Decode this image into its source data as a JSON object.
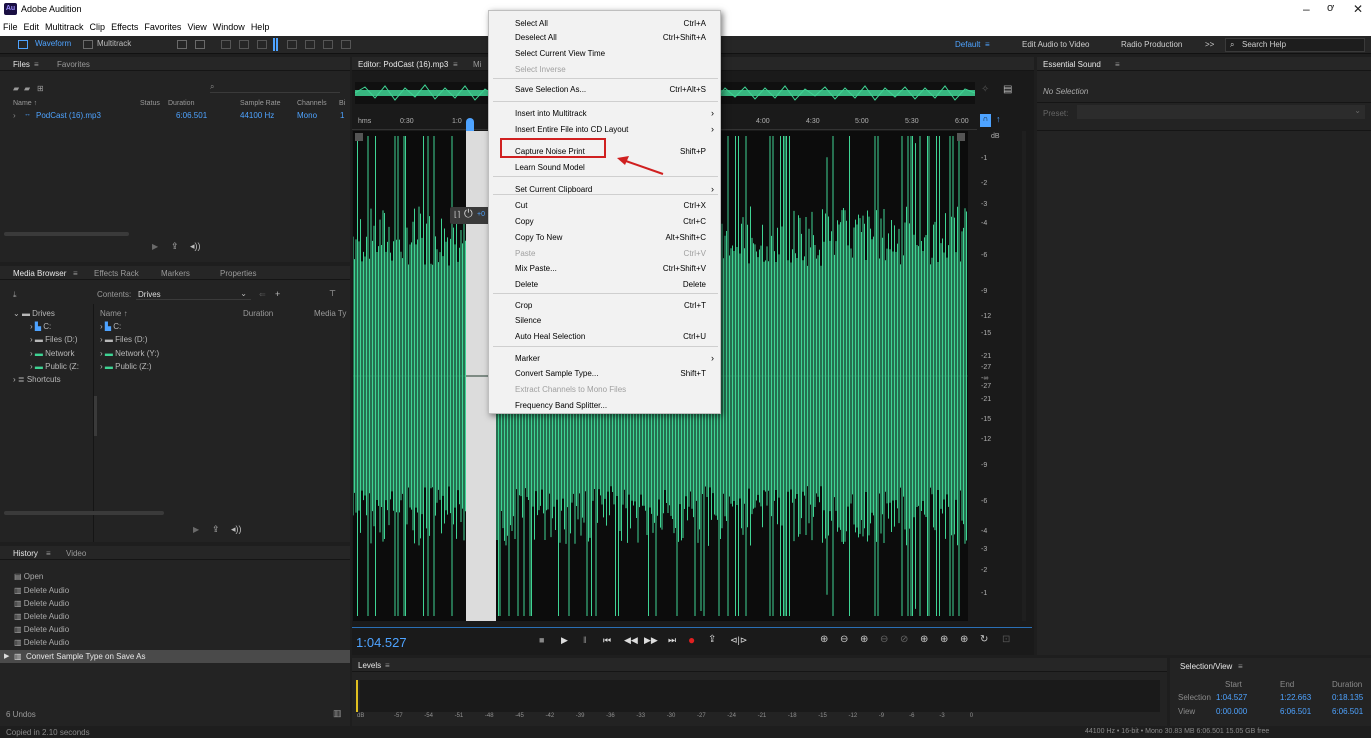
{
  "app": {
    "title": "Adobe Audition",
    "logo": "Au"
  },
  "menu": [
    "File",
    "Edit",
    "Multitrack",
    "Clip",
    "Effects",
    "Favorites",
    "View",
    "Window",
    "Help"
  ],
  "toolbar": {
    "waveform": "Waveform",
    "multitrack": "Multitrack",
    "workspaces": [
      "Default",
      "Edit Audio to Video",
      "Radio Production"
    ],
    "overflow": ">>",
    "search_placeholder": "Search Help"
  },
  "files_panel": {
    "tabs": [
      "Files",
      "Favorites"
    ],
    "columns": [
      "Name ↑",
      "Status",
      "Duration",
      "Sample Rate",
      "Channels",
      "Bi"
    ],
    "file": {
      "name": "PodCast (16).mp3",
      "duration": "6:06.501",
      "sample_rate": "44100 Hz",
      "channels": "Mono",
      "bits": "1"
    }
  },
  "media_browser": {
    "tabs": [
      "Media Browser",
      "Effects Rack",
      "Markers",
      "Properties"
    ],
    "contents_label": "Contents:",
    "contents_value": "Drives",
    "columns": [
      "Name ↑",
      "Duration",
      "Media Ty"
    ],
    "left_tree": [
      "Drives",
      "C:",
      "Files (D:)",
      "Network",
      "Public (Z:",
      "Shortcuts"
    ],
    "right_list": [
      "C:",
      "Files (D:)",
      "Network (Y:)",
      "Public (Z:)"
    ]
  },
  "history": {
    "tabs": [
      "History",
      "Video"
    ],
    "items": [
      "Open",
      "Delete Audio",
      "Delete Audio",
      "Delete Audio",
      "Delete Audio",
      "Delete Audio",
      "Convert Sample Type on Save As"
    ],
    "undos": "6 Undos"
  },
  "status_left": "Copied in 2.10 seconds",
  "editor": {
    "tab": "Editor: PodCast (16).mp3",
    "tab2": "Mi",
    "ruler_unit": "hms",
    "ruler": [
      "0:30",
      "1:0",
      "4:00",
      "4:30",
      "5:00",
      "5:30",
      "6:00"
    ],
    "db_unit": "dB",
    "db_scale": [
      "-1",
      "-2",
      "-3",
      "-4",
      "-6",
      "-9",
      "-12",
      "-15",
      "-21",
      "-27",
      "-∞",
      "-27",
      "-21",
      "-15",
      "-12",
      "-9",
      "-6",
      "-4",
      "-3",
      "-2",
      "-1"
    ],
    "time": "1:04.527",
    "gain_partial": "+0"
  },
  "essential_sound": {
    "title": "Essential Sound",
    "no_selection": "No Selection",
    "preset": "Preset:"
  },
  "levels": {
    "title": "Levels",
    "unit": "dB",
    "scale": [
      "-57",
      "-54",
      "-51",
      "-48",
      "-45",
      "-42",
      "-39",
      "-36",
      "-33",
      "-30",
      "-27",
      "-24",
      "-21",
      "-18",
      "-15",
      "-12",
      "-9",
      "-6",
      "-3",
      "0"
    ]
  },
  "selection_view": {
    "title": "Selection/View",
    "headers": [
      "Start",
      "End",
      "Duration"
    ],
    "selection": {
      "label": "Selection",
      "start": "1:04.527",
      "end": "1:22.663",
      "duration": "0:18.135"
    },
    "view": {
      "label": "View",
      "start": "0:00.000",
      "end": "6:06.501",
      "duration": "6:06.501"
    }
  },
  "status_right": "44100 Hz • 16-bit • Mono   30.83 MB   6:06.501   15.05 GB free",
  "context_menu": [
    {
      "label": "Select All",
      "shortcut": "Ctrl+A"
    },
    {
      "label": "Deselect All",
      "shortcut": "Ctrl+Shift+A"
    },
    {
      "label": "Select Current View Time",
      "shortcut": ""
    },
    {
      "label": "Select Inverse",
      "shortcut": "",
      "disabled": true
    },
    {
      "label": "Save Selection As...",
      "shortcut": "Ctrl+Alt+S"
    },
    {
      "label": "Insert into Multitrack",
      "shortcut": ""
    },
    {
      "label": "Insert Entire File into CD Layout",
      "shortcut": ""
    },
    {
      "label": "Capture Noise Print",
      "shortcut": "Shift+P"
    },
    {
      "label": "Learn Sound Model",
      "shortcut": ""
    },
    {
      "label": "Set Current Clipboard",
      "shortcut": ""
    },
    {
      "label": "Cut",
      "shortcut": "Ctrl+X"
    },
    {
      "label": "Copy",
      "shortcut": "Ctrl+C"
    },
    {
      "label": "Copy To New",
      "shortcut": "Alt+Shift+C"
    },
    {
      "label": "Paste",
      "shortcut": "Ctrl+V",
      "disabled": true
    },
    {
      "label": "Mix Paste...",
      "shortcut": "Ctrl+Shift+V"
    },
    {
      "label": "Delete",
      "shortcut": "Delete"
    },
    {
      "label": "Crop",
      "shortcut": "Ctrl+T"
    },
    {
      "label": "Silence",
      "shortcut": ""
    },
    {
      "label": "Auto Heal Selection",
      "shortcut": "Ctrl+U"
    },
    {
      "label": "Marker",
      "shortcut": ""
    },
    {
      "label": "Convert Sample Type...",
      "shortcut": "Shift+T"
    },
    {
      "label": "Extract Channels to Mono Files",
      "shortcut": "",
      "disabled": true
    },
    {
      "label": "Frequency Band Splitter...",
      "shortcut": ""
    }
  ],
  "colors": {
    "waveform": "#3fd494",
    "accent": "#4ea3ff",
    "highlight_box": "#d02020",
    "record": "#e02020"
  }
}
